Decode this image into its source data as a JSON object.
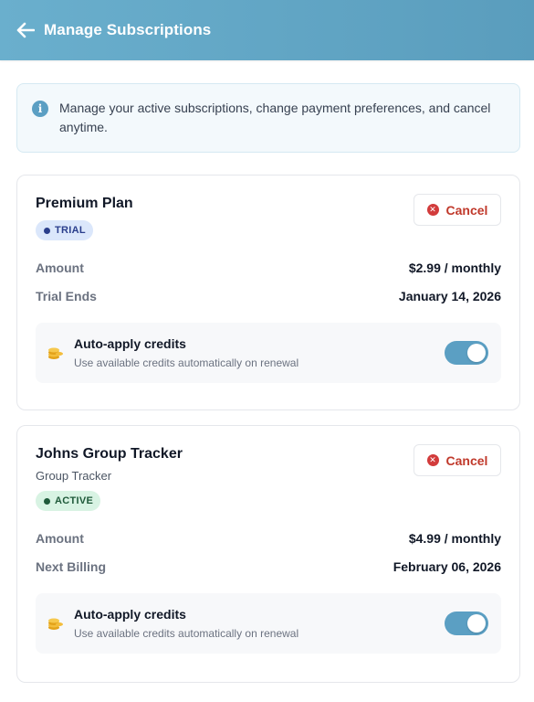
{
  "header": {
    "title": "Manage Subscriptions",
    "back_icon": "arrow-left-icon",
    "background": "#62a6c6"
  },
  "info": {
    "icon": "info-icon",
    "text": "Manage your active subscriptions, change payment preferences, and cancel anytime."
  },
  "subscriptions": [
    {
      "title": "Premium Plan",
      "subtitle": "",
      "badge": "TRIAL",
      "badge_color": "#2a3e8c",
      "cancel_label": "Cancel",
      "rows": [
        {
          "label": "Amount",
          "value": "$2.99 / monthly"
        },
        {
          "label": "Trial Ends",
          "value": "January 14, 2026"
        }
      ],
      "credits": {
        "title": "Auto-apply credits",
        "description": "Use available credits automatically on renewal",
        "enabled": true
      }
    },
    {
      "title": "Johns Group Tracker",
      "subtitle": "Group Tracker",
      "badge": "ACTIVE",
      "badge_color": "#1f5a3a",
      "cancel_label": "Cancel",
      "rows": [
        {
          "label": "Amount",
          "value": "$4.99 / monthly"
        },
        {
          "label": "Next Billing",
          "value": "February 06, 2026"
        }
      ],
      "credits": {
        "title": "Auto-apply credits",
        "description": "Use available credits automatically on renewal",
        "enabled": true
      }
    }
  ],
  "colors": {
    "accent": "#5b9fc3",
    "cancel": "#c0392b"
  }
}
